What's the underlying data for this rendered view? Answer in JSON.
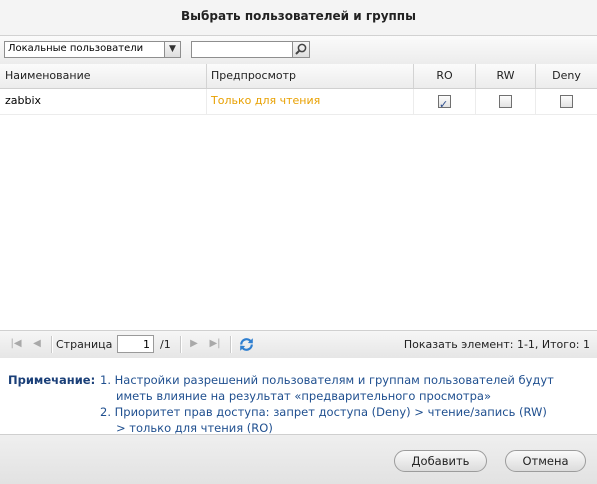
{
  "dialog": {
    "title": "Выбрать пользователей и группы"
  },
  "toolbar": {
    "scope_select": "Локальные пользователи",
    "search_value": ""
  },
  "grid": {
    "columns": {
      "name": "Наименование",
      "preview": "Предпросмотр",
      "ro": "RO",
      "rw": "RW",
      "deny": "Deny"
    },
    "rows": [
      {
        "name": "zabbix",
        "preview": "Только для чтения",
        "ro": true,
        "rw": false,
        "deny": false
      }
    ],
    "preview_color": "#e8a000"
  },
  "pager": {
    "page_label": "Страница",
    "page_value": "1",
    "total_pages": "/1",
    "status": "Показать элемент: 1-1, Итого: 1"
  },
  "note": {
    "label": "Примечание:",
    "line1a": "1. Настройки разрешений пользователям и группам пользователей будут",
    "line1b": "иметь влияние на результат «предварительного просмотра»",
    "line2a": "2. Приоритет прав доступа: запрет доступа (Deny) > чтение/запись (RW)",
    "line2b": "> только для чтения (RO)"
  },
  "footer": {
    "add_label": "Добавить",
    "cancel_label": "Отмена"
  }
}
